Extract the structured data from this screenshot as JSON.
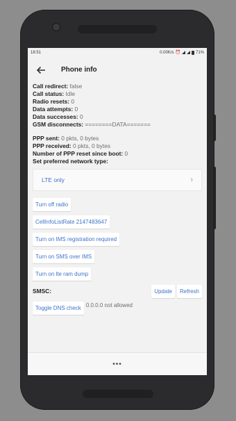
{
  "status_bar": {
    "time": "18:51",
    "speed": "0.00K/s",
    "battery": "71%"
  },
  "app_bar": {
    "title": "Phone info"
  },
  "info_lines": [
    {
      "label": "Call redirect:",
      "value": "false"
    },
    {
      "label": "Call status:",
      "value": "Idle"
    },
    {
      "label": "Radio resets:",
      "value": "0"
    },
    {
      "label": "Data attempts:",
      "value": "0"
    },
    {
      "label": "Data successes:",
      "value": "0"
    },
    {
      "label": "GSM disconnects:",
      "value": "========DATA======="
    }
  ],
  "info_lines2": [
    {
      "label": "PPP sent:",
      "value": "0 pkts, 0 bytes"
    },
    {
      "label": "PPP received:",
      "value": "0 pkts, 0 bytes"
    },
    {
      "label": "Number of PPP reset since boot:",
      "value": "0"
    },
    {
      "label": "Set preferred network type:",
      "value": ""
    }
  ],
  "network_type": {
    "selected": "LTE only"
  },
  "buttons": {
    "radio": "Turn off radio",
    "cell_info_rate": "CellInfoListRate 2147483647",
    "ims": "Turn on IMS registration required",
    "sms_over_ims": "Turn on SMS over IMS",
    "ram_dump": "Turn on lte ram dump",
    "update": "Update",
    "refresh": "Refresh",
    "dns": "Toggle DNS check"
  },
  "smsc": {
    "label": "SMSC:"
  },
  "dns_status": "0.0.0.0 not allowed",
  "nav": {
    "overflow": "•••"
  }
}
